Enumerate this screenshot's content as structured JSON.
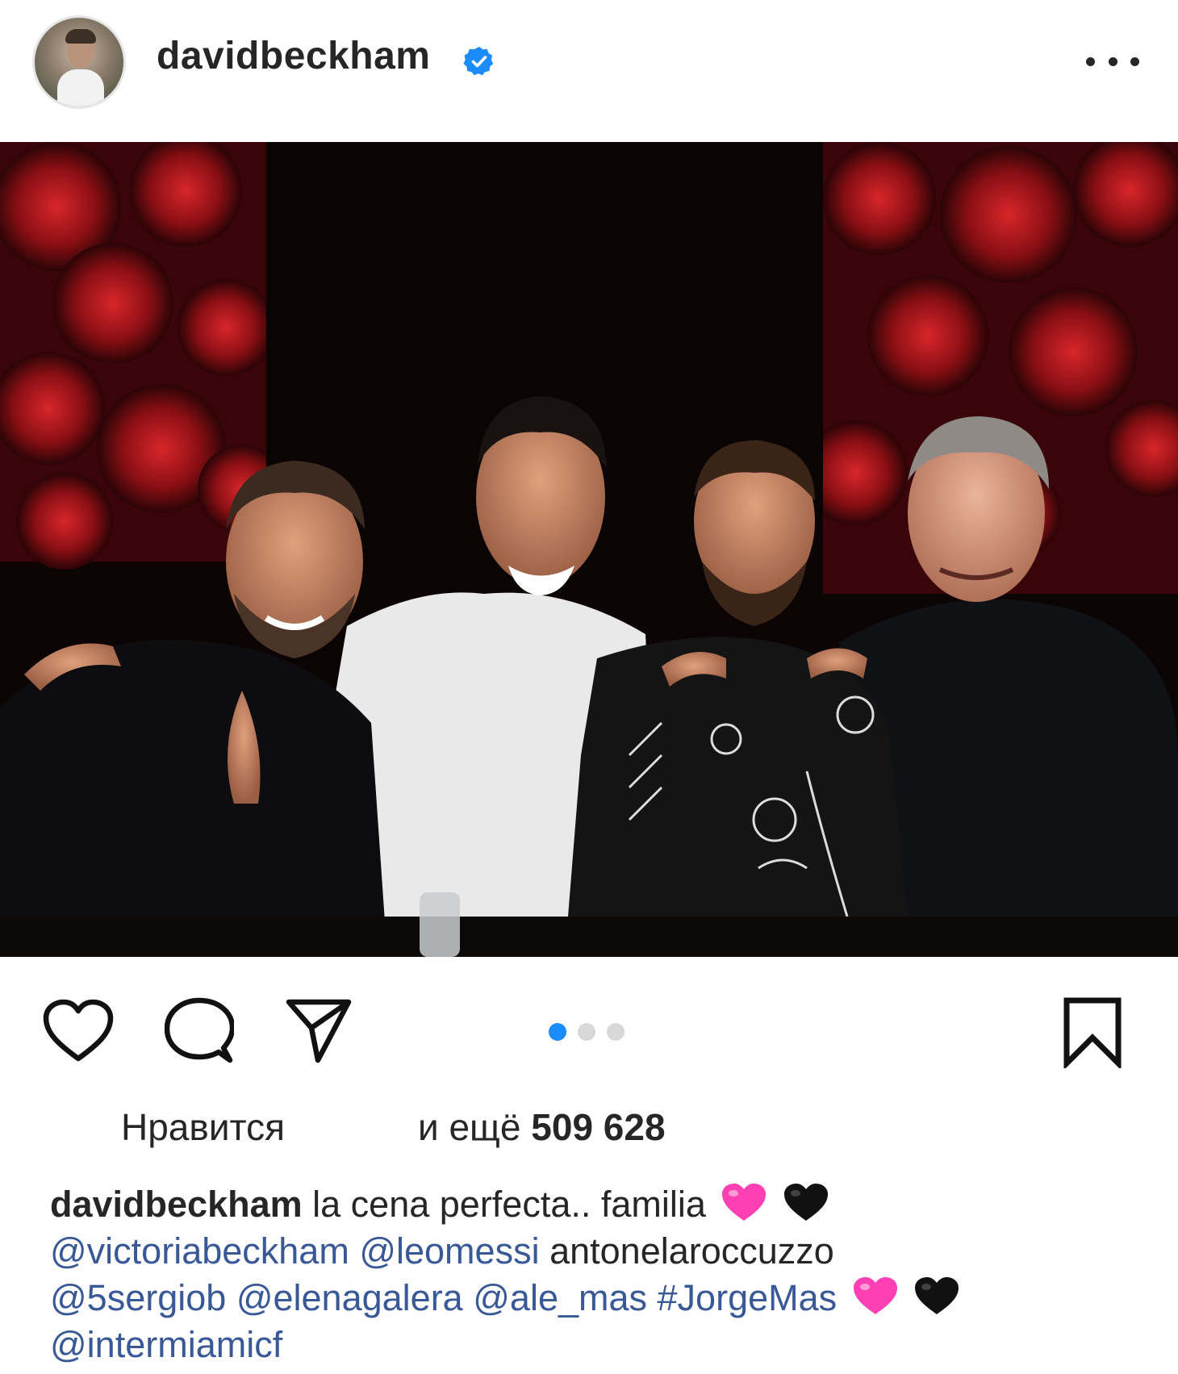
{
  "post": {
    "author": {
      "username": "davidbeckham",
      "verified": true,
      "avatar_icon": "profile-photo"
    },
    "more_icon": "more-horizontal-icon",
    "carousel": {
      "count": 3,
      "active_index": 0
    },
    "likes": {
      "label": "Нравится",
      "conjunction": "и ещё",
      "count": "509 628"
    },
    "caption": {
      "username": "davidbeckham",
      "text": "la cena perfecta.. familia",
      "line2": [
        {
          "text": "@victoriabeckham",
          "type": "mention"
        },
        {
          "text": "@leomessi",
          "type": "mention"
        },
        {
          "text": "antonelaroccuzzo",
          "type": "plain"
        }
      ],
      "line3": [
        {
          "text": "@5sergiob",
          "type": "mention"
        },
        {
          "text": "@elenagalera",
          "type": "mention"
        },
        {
          "text": "@ale_mas",
          "type": "mention"
        },
        {
          "text": "#JorgeMas",
          "type": "mention"
        }
      ],
      "line4": [
        {
          "text": "@intermiamicf",
          "type": "mention"
        }
      ],
      "emojis": [
        "pink-heart",
        "black-heart"
      ]
    }
  },
  "colors": {
    "accent": "#1a8cff",
    "link": "#385898",
    "text": "#262626",
    "pink_heart": "#ff3fb4",
    "black_heart": "#111111"
  }
}
